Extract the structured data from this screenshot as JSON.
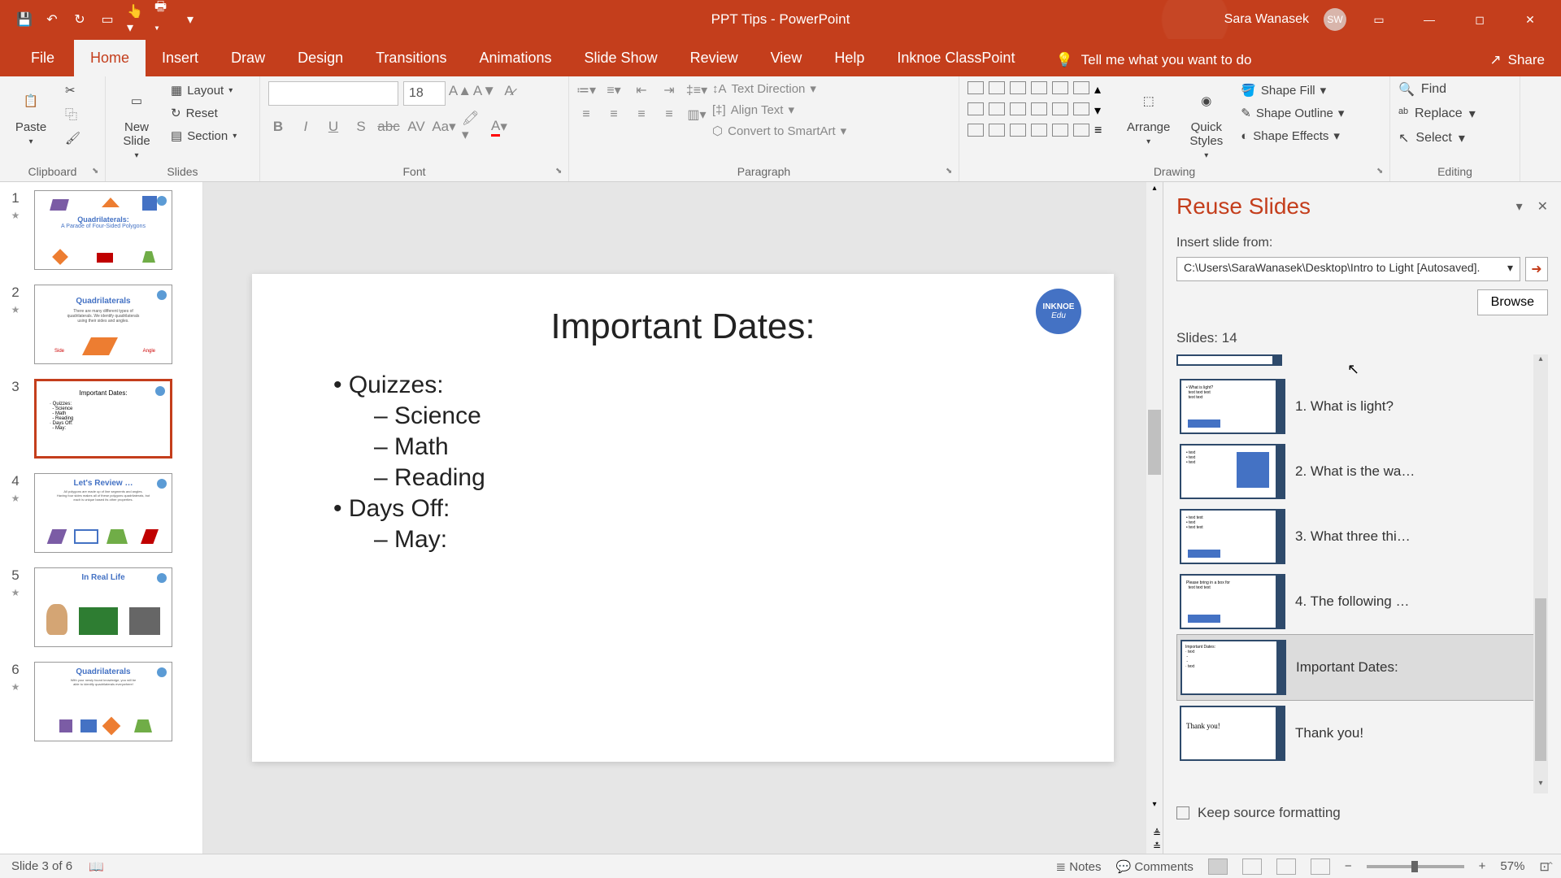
{
  "titlebar": {
    "doc_title": "PPT Tips  -  PowerPoint",
    "user_name": "Sara Wanasek",
    "user_initials": "SW"
  },
  "tabs": {
    "file": "File",
    "home": "Home",
    "insert": "Insert",
    "draw": "Draw",
    "design": "Design",
    "transitions": "Transitions",
    "animations": "Animations",
    "slideshow": "Slide Show",
    "review": "Review",
    "view": "View",
    "help": "Help",
    "inknoe": "Inknoe ClassPoint",
    "tellme": "Tell me what you want to do",
    "share": "Share"
  },
  "ribbon": {
    "clipboard": {
      "label": "Clipboard",
      "paste": "Paste"
    },
    "slides": {
      "label": "Slides",
      "new_slide": "New\nSlide",
      "layout": "Layout",
      "reset": "Reset",
      "section": "Section"
    },
    "font": {
      "label": "Font",
      "size": "18"
    },
    "paragraph": {
      "label": "Paragraph",
      "text_direction": "Text Direction",
      "align_text": "Align Text",
      "smartart": "Convert to SmartArt"
    },
    "drawing": {
      "label": "Drawing",
      "arrange": "Arrange",
      "quick_styles": "Quick\nStyles",
      "shape_fill": "Shape Fill",
      "shape_outline": "Shape Outline",
      "shape_effects": "Shape Effects"
    },
    "editing": {
      "label": "Editing",
      "find": "Find",
      "replace": "Replace",
      "select": "Select"
    }
  },
  "thumbs": [
    {
      "num": "1",
      "title": "Quadrilaterals:",
      "sub": "A Parade of Four-Sided Polygons"
    },
    {
      "num": "2",
      "title": "Quadrilaterals"
    },
    {
      "num": "3",
      "title": "Important Dates:",
      "selected": true
    },
    {
      "num": "4",
      "title": "Let's Review …"
    },
    {
      "num": "5",
      "title": "In Real Life"
    },
    {
      "num": "6",
      "title": "Quadrilaterals"
    }
  ],
  "slide": {
    "title": "Important Dates:",
    "bullets": [
      {
        "text": "Quizzes:",
        "sub": [
          "Science",
          "Math",
          "Reading"
        ]
      },
      {
        "text": "Days Off:",
        "sub": [
          "May:"
        ]
      }
    ],
    "logo_top": "INKNOE",
    "logo_bottom": "Edu"
  },
  "reuse": {
    "title": "Reuse Slides",
    "insert_label": "Insert slide from:",
    "path": "C:\\Users\\SaraWanasek\\Desktop\\Intro to Light [Autosaved].",
    "browse": "Browse",
    "count": "Slides: 14",
    "items": [
      {
        "label": "1. What is light?"
      },
      {
        "label": "2. What is the wa…"
      },
      {
        "label": "3. What three thi…"
      },
      {
        "label": "4. The following …"
      },
      {
        "label": "Important Dates:",
        "highlight": true
      },
      {
        "label": "Thank you!"
      }
    ],
    "keep": "Keep source formatting"
  },
  "status": {
    "slide": "Slide 3 of 6",
    "notes": "Notes",
    "comments": "Comments",
    "zoom": "57%"
  }
}
